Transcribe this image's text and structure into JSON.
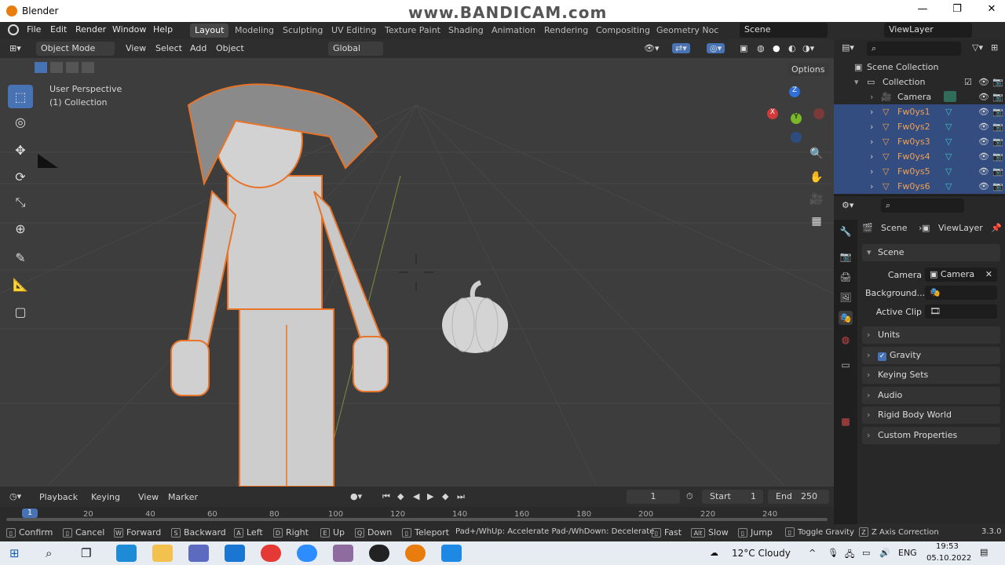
{
  "window": {
    "title": "Blender",
    "watermark": "www.BANDICAM.com",
    "controls": [
      "—",
      "❐",
      "✕"
    ]
  },
  "menus": [
    "File",
    "Edit",
    "Render",
    "Window",
    "Help"
  ],
  "workspaces": [
    "Layout",
    "Modeling",
    "Sculpting",
    "UV Editing",
    "Texture Paint",
    "Shading",
    "Animation",
    "Rendering",
    "Compositing",
    "Geometry Noc"
  ],
  "active_workspace": "Layout",
  "scene_field": "Scene",
  "viewlayer_field": "ViewLayer",
  "viewport": {
    "mode": "Object Mode",
    "menus": [
      "View",
      "Select",
      "Add",
      "Object"
    ],
    "transform": "Global",
    "options": "Options",
    "overlay_title": "User Perspective",
    "overlay_subtitle": "(1) Collection",
    "gizmo": {
      "z": "Z",
      "y": "Y",
      "x": "X"
    }
  },
  "outliner": {
    "search_placeholder": "",
    "rows": [
      {
        "name": "Scene Collection",
        "type": "scene"
      },
      {
        "name": "Collection",
        "type": "collection"
      },
      {
        "name": "Camera",
        "type": "camera"
      },
      {
        "name": "Fw0ys1",
        "type": "mesh"
      },
      {
        "name": "Fw0ys2",
        "type": "mesh"
      },
      {
        "name": "Fw0ys3",
        "type": "mesh"
      },
      {
        "name": "Fw0ys4",
        "type": "mesh"
      },
      {
        "name": "Fw0ys5",
        "type": "mesh"
      },
      {
        "name": "Fw0ys6",
        "type": "mesh"
      }
    ]
  },
  "properties": {
    "breadcrumb_scene": "Scene",
    "breadcrumb_viewlayer": "ViewLayer",
    "section_scene": "Scene",
    "camera_label": "Camera",
    "camera_value": "Camera",
    "background_label": "Background...",
    "active_clip_label": "Active Clip",
    "sections": [
      "Units",
      "Gravity",
      "Keying Sets",
      "Audio",
      "Rigid Body World",
      "Custom Properties"
    ]
  },
  "timeline": {
    "menus": [
      "Playback",
      "Keying",
      "View",
      "Marker"
    ],
    "current_frame": "1",
    "start_label": "Start",
    "start": "1",
    "end_label": "End",
    "end": "250",
    "ticks": [
      "1",
      "20",
      "40",
      "60",
      "80",
      "100",
      "120",
      "140",
      "160",
      "180",
      "200",
      "220",
      "240"
    ]
  },
  "statusbar": {
    "items": [
      {
        "key": "",
        "label": "Confirm"
      },
      {
        "key": "",
        "label": "Cancel"
      },
      {
        "key": "W",
        "label": "Forward"
      },
      {
        "key": "S",
        "label": "Backward"
      },
      {
        "key": "A",
        "label": "Left"
      },
      {
        "key": "D",
        "label": "Right"
      },
      {
        "key": "E",
        "label": "Up"
      },
      {
        "key": "Q",
        "label": "Down"
      },
      {
        "key": "",
        "label": "Teleport"
      },
      {
        "key": "",
        "label": "Pad+/WhUp: Accelerate Pad-/WhDown: Decelerate"
      },
      {
        "key": "",
        "label": "Fast"
      },
      {
        "key": "Alt",
        "label": "Slow"
      },
      {
        "key": "",
        "label": "Jump"
      },
      {
        "key": "",
        "label": "Toggle Gravity"
      },
      {
        "key": "Z",
        "label": "Z Axis Correction"
      }
    ],
    "version": "3.3.0"
  },
  "taskbar": {
    "weather": "12°C  Cloudy",
    "lang": "ENG",
    "time": "19:53",
    "date": "05.10.2022"
  },
  "colors": {
    "accent": "#4772b3",
    "selected_row": "#334d80",
    "object_text": "#f0a050",
    "outline": "#e8742a"
  }
}
